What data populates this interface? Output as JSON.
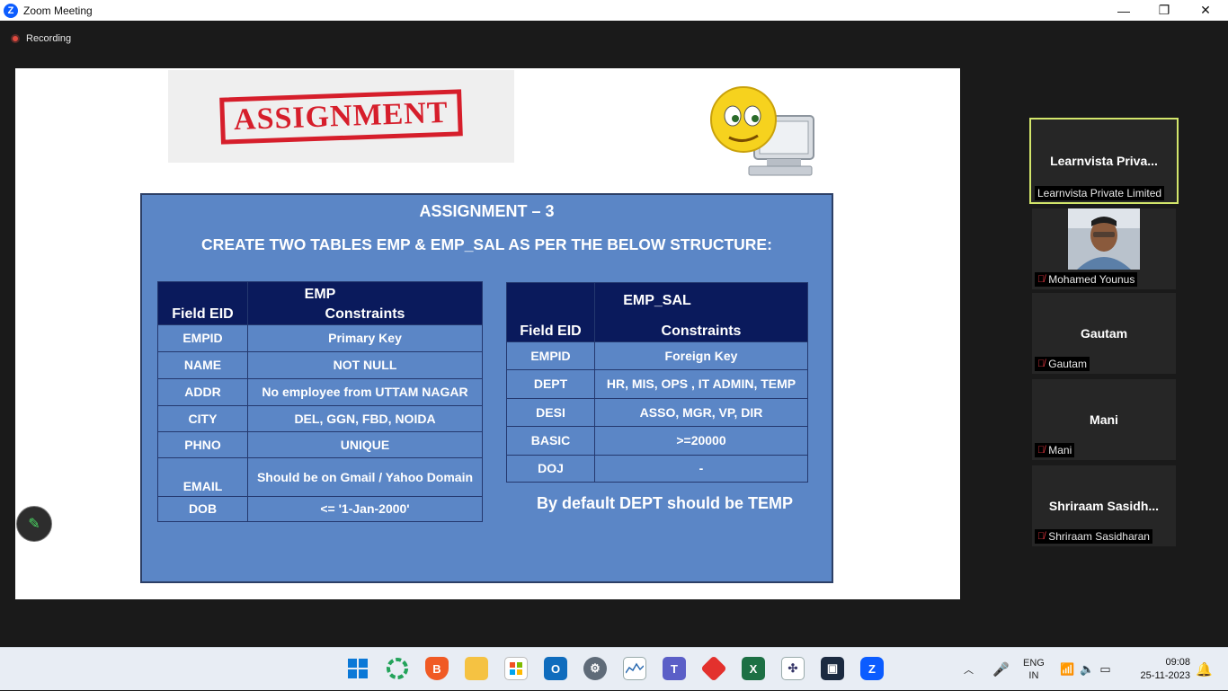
{
  "window": {
    "title": "Zoom Meeting",
    "logo_letter": "Z",
    "minimize": "—",
    "maximize": "❐",
    "close": "✕"
  },
  "recording": {
    "label": "Recording"
  },
  "slide": {
    "stamp_text": "ASSIGNMENT",
    "heading": "ASSIGNMENT – 3",
    "subheading": "CREATE TWO  TABLES EMP & EMP_SAL AS PER THE BELOW STRUCTURE:",
    "emp": {
      "title": "EMP",
      "col1": "Field EID",
      "col2": "Constraints",
      "rows": [
        {
          "field": "EMPID",
          "constraint": "Primary Key"
        },
        {
          "field": "NAME",
          "constraint": "NOT NULL"
        },
        {
          "field": "ADDR",
          "constraint": "No employee from UTTAM NAGAR"
        },
        {
          "field": "CITY",
          "constraint": "DEL, GGN, FBD, NOIDA"
        },
        {
          "field": "PHNO",
          "constraint": "UNIQUE"
        },
        {
          "field": "EMAIL",
          "constraint": "Should be on Gmail / Yahoo Domain"
        },
        {
          "field": "DOB",
          "constraint": "<= '1-Jan-2000'"
        }
      ]
    },
    "emp_sal": {
      "title": "EMP_SAL",
      "col1": "Field EID",
      "col2": "Constraints",
      "rows": [
        {
          "field": "EMPID",
          "constraint": "Foreign Key"
        },
        {
          "field": "DEPT",
          "constraint": "HR, MIS, OPS , IT ADMIN, TEMP"
        },
        {
          "field": "DESI",
          "constraint": "ASSO, MGR, VP, DIR"
        },
        {
          "field": "BASIC",
          "constraint": ">=20000"
        },
        {
          "field": "DOJ",
          "constraint": "-"
        }
      ]
    },
    "note": "By default DEPT should be TEMP"
  },
  "participants": [
    {
      "name": "Learnvista  Priva...",
      "caption": "Learnvista Private Limited",
      "muted": false,
      "active": true
    },
    {
      "name": "",
      "caption": "Mohamed Younus",
      "muted": true,
      "active": false,
      "has_video": true
    },
    {
      "name": "Gautam",
      "caption": "Gautam",
      "muted": true,
      "active": false
    },
    {
      "name": "Mani",
      "caption": "Mani",
      "muted": true,
      "active": false
    },
    {
      "name": "Shriraam  Sasidh...",
      "caption": "Shriraam Sasidharan",
      "muted": true,
      "active": false
    }
  ],
  "taskbar": {
    "lang_top": "ENG",
    "lang_bottom": "IN",
    "time": "09:08",
    "date": "25-11-2023"
  }
}
